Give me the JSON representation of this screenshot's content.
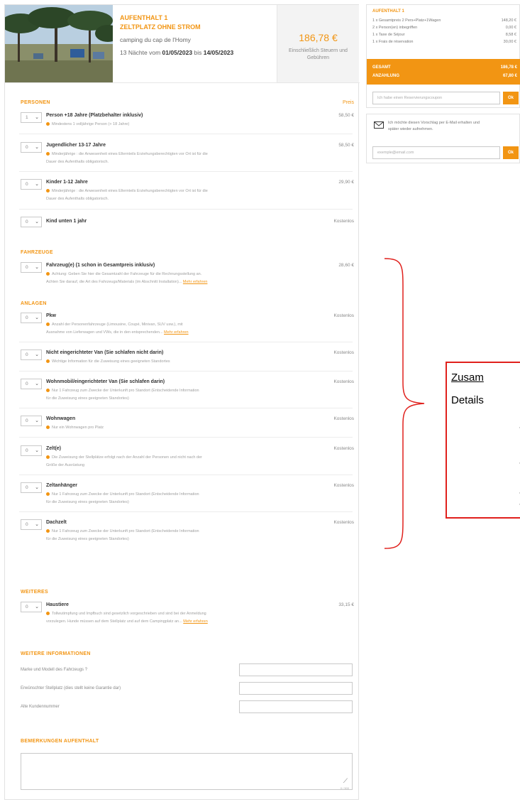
{
  "stay": {
    "title": "AUFENTHALT 1",
    "subtitle": "ZELTPLATZ OHNE STROM",
    "campsite": "camping du cap de l'Homy",
    "nights_prefix": "13 Nächte vom",
    "date_from": "01/05/2023",
    "date_sep": "bis",
    "date_to": "14/05/2023",
    "price": "186,78 €",
    "price_note": "Einschließlich Steuern und Gebühren"
  },
  "sections": {
    "personen": "PERSONEN",
    "preis": "Preis",
    "fahrzeuge": "FAHRZEUGE",
    "anlagen": "ANLAGEN",
    "weiteres": "WEITERES",
    "weitere_info": "WEITERE INFORMATIONEN",
    "bemerkungen": "BEMERKUNGEN AUFENTHALT"
  },
  "more_link": "Mehr erfahren",
  "rows": [
    {
      "qty": "1",
      "title": "Person +18 Jahre (Platzbehalter inklusiv)",
      "note": "Mindestens 1 volljährige Person (+ 18 Jahre)",
      "note2": "",
      "more": false,
      "price": "58,50 €"
    },
    {
      "qty": "0",
      "title": "Jugendlicher 13-17 Jahre",
      "note": "Minderjährige : die Anwesenheit eines Elternteils Erziehungsberechtigten vor Ort ist für die",
      "note2": "Dauer des Aufenthalts obligatorisch.",
      "more": false,
      "price": "58,50 €"
    },
    {
      "qty": "0",
      "title": "Kinder 1-12 Jahre",
      "note": "Minderjährige : die Anwesenheit eines Elternteils Erziehungsberechtigten vor Ort ist für die",
      "note2": "Dauer des Aufenthalts obligatorisch.",
      "more": false,
      "price": "29,90 €"
    },
    {
      "qty": "0",
      "title": "Kind unten 1 jahr",
      "note": "",
      "note2": "",
      "more": false,
      "price": "Kostenlos"
    },
    {
      "qty": "0",
      "title": "Fahrzeug(e) (1 schon in Gesamtpreis inklusiv)",
      "note": "Achtung: Geben Sie hier die Gesamtzahl der Fahrzeuge für die Rechnungsstellung an.",
      "note2": "Achten Sie darauf, die Art des Fahrzeugs/Materials (im Abschnitt Installation)...",
      "more": true,
      "price": "28,60 €"
    },
    {
      "qty": "0",
      "title": "Pkw",
      "note": "Anzahl der Personenfahrzeuge (Limousine, Coupé, Minivan, SUV usw.), mit",
      "note2": "Ausnahme von Lieferwagen und VWs, die in den entsprechenden...",
      "more": true,
      "price": "Kostenlos"
    },
    {
      "qty": "0",
      "title": "Nicht eingerichteter Van (Sie schlafen nicht darin)",
      "note": "Wichtige Information für die Zuweisung eines geeigneten Standortes",
      "note2": "",
      "more": false,
      "price": "Kostenlos"
    },
    {
      "qty": "0",
      "title": "Wohnmobil/eingerichteter Van (Sie schlafen darin)",
      "note": "Nur 1 Fahrzeug zum Zwecke der Unterkunft pro Standort (Entscheidende Information",
      "note2": "für die Zuweisung eines geeigneten Standortes)",
      "more": false,
      "price": "Kostenlos"
    },
    {
      "qty": "0",
      "title": "Wohnwagen",
      "note": "Nur ein Wohnwagen pro Platz",
      "note2": "",
      "more": false,
      "price": "Kostenlos"
    },
    {
      "qty": "0",
      "title": "Zelt(e)",
      "note": "Die Zuweisung der Stellplätze erfolgt nach der Anzahl der Personen und nicht nach der",
      "note2": "Größe der Ausrüstung",
      "more": false,
      "price": "Kostenlos"
    },
    {
      "qty": "0",
      "title": "Zeltanhänger",
      "note": "Nur 1 Fahrzeug zum Zwecke der Unterkunft pro Standort (Entscheidende Information",
      "note2": "für die Zuweisung eines geeigneten Standortes)",
      "more": false,
      "price": "Kostenlos"
    },
    {
      "qty": "0",
      "title": "Dachzelt",
      "note": "Nur 1 Fahrzeug zum Zwecke der Unterkunft pro Standort (Entscheidende Information",
      "note2": "für die Zuweisung eines geeigneten Standortes)",
      "more": false,
      "price": "Kostenlos"
    },
    {
      "qty": "0",
      "title": "Haustiere",
      "note": "Tollwutimpfung und Impfbuch sind gesetzlich vorgeschrieben und sind bei der Anmeldung",
      "note2": "vorzulegen. Hunde müssen auf dem Stellplatz und auf dem Campingplatz an...",
      "more": true,
      "price": "33,15 €"
    }
  ],
  "info_fields": [
    {
      "label": "Marke und Modell des Fahrzeugs ?",
      "value": ""
    },
    {
      "label": "Erwünschter Stellplatz (dies stellt keine Garantie dar)",
      "value": ""
    },
    {
      "label": "Alte Kundennummer",
      "value": ""
    }
  ],
  "remarks_counter": "0 / 500",
  "summary": {
    "title": "AUFENTHALT 1",
    "lines": [
      {
        "label": "1 x Gesamtpreis 2 Pers+Platz+1Wagen",
        "value": "148,20 €"
      },
      {
        "label": "2 x Person(en) inbegriffen",
        "value": "0,00 €"
      },
      {
        "label": "1 x Taxe de Séjour",
        "value": "8,58 €"
      },
      {
        "label": "1 x Frais de réservation",
        "value": "30,00 €"
      }
    ],
    "total_label": "GESAMT",
    "total_value": "186,78 €",
    "deposit_label": "ANZAHLUNG",
    "deposit_value": "67,80 €",
    "coupon_placeholder": "Ich habe einen Reservierungscoupon",
    "ok_label": "Ok"
  },
  "mail": {
    "text_line1": "Ich möchte diesen Vorschlag per E-Mail erhalten und",
    "text_line2": "später wieder aufnehmen.",
    "placeholder": "exemple@email.com",
    "ok_label": "Ok"
  },
  "annotation": {
    "heading": "Zusam",
    "line2": "Details",
    "dashes": [
      "-",
      "-",
      "-",
      "-"
    ]
  },
  "colors": {
    "accent": "#f29513",
    "annotation_red": "#e0201c"
  }
}
